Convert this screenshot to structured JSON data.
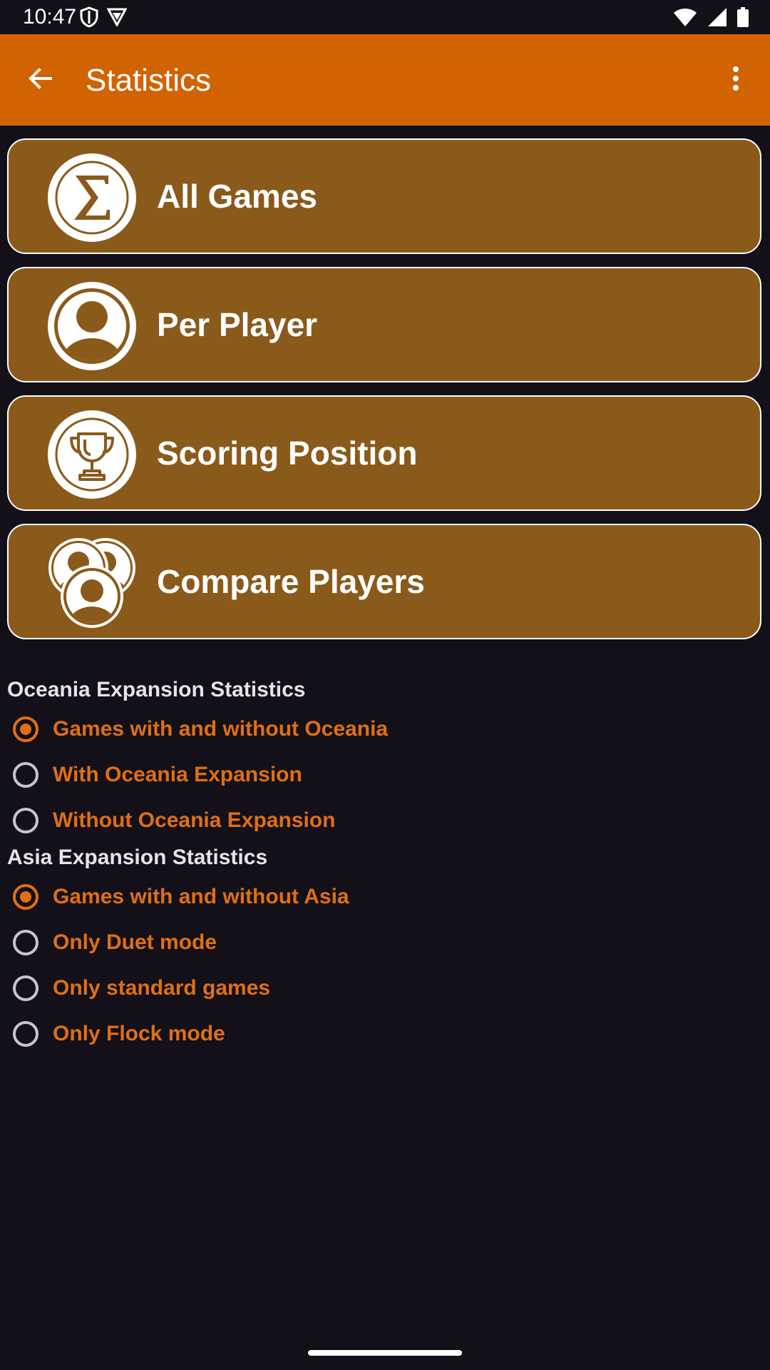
{
  "status_bar": {
    "time": "10:47",
    "left_icons": [
      "shield-icon",
      "vpn-icon"
    ],
    "right_icons": [
      "wifi-icon",
      "signal-icon",
      "battery-icon"
    ]
  },
  "app_bar": {
    "title": "Statistics",
    "back_icon": "arrow-left-icon",
    "menu_icon": "more-vert-icon",
    "color": "#D16300"
  },
  "cards": [
    {
      "label": "All Games",
      "icon": "sigma-icon"
    },
    {
      "label": "Per Player",
      "icon": "person-icon"
    },
    {
      "label": "Scoring Position",
      "icon": "trophy-icon"
    },
    {
      "label": "Compare Players",
      "icon": "people-group-icon"
    }
  ],
  "oceania": {
    "header": "Oceania Expansion Statistics",
    "options": [
      {
        "label": "Games with and without Oceania",
        "checked": true
      },
      {
        "label": "With Oceania Expansion",
        "checked": false
      },
      {
        "label": "Without Oceania Expansion",
        "checked": false
      }
    ]
  },
  "asia": {
    "header": "Asia Expansion Statistics",
    "options": [
      {
        "label": "Games with and without Asia",
        "checked": true
      },
      {
        "label": "Only Duet mode",
        "checked": false
      },
      {
        "label": "Only standard games",
        "checked": false
      },
      {
        "label": "Only Flock mode",
        "checked": false
      }
    ]
  },
  "colors": {
    "card_bg": "#8A5A1B",
    "accent": "#E06F14",
    "background": "#131019"
  }
}
